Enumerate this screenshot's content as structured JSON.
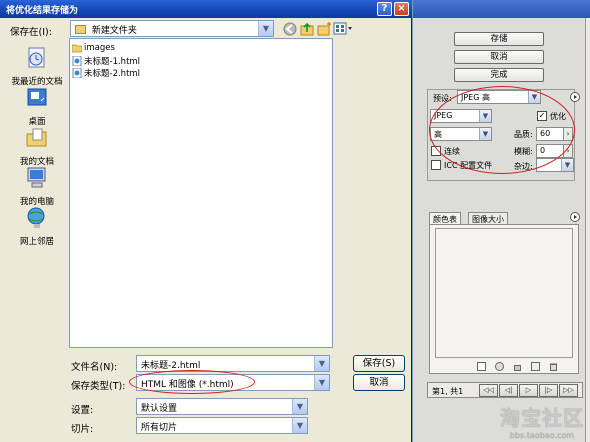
{
  "window": {
    "title": "将优化结果存储为",
    "help_glyph": "?",
    "close_glyph": "×"
  },
  "toolbar": {
    "save_in_label": "保存在(I):",
    "save_in_value": "新建文件夹"
  },
  "places": [
    {
      "label": "我最近的文档",
      "icon": "recent-documents-icon"
    },
    {
      "label": "桌面",
      "icon": "desktop-icon"
    },
    {
      "label": "我的文档",
      "icon": "my-documents-icon"
    },
    {
      "label": "我的电脑",
      "icon": "my-computer-icon"
    },
    {
      "label": "网上邻居",
      "icon": "network-places-icon"
    }
  ],
  "files": [
    {
      "name": "images",
      "icon": "folder-icon"
    },
    {
      "name": "未标题-1.html",
      "icon": "html-file-icon"
    },
    {
      "name": "未标题-2.html",
      "icon": "html-file-icon"
    }
  ],
  "form": {
    "filename_label": "文件名(N):",
    "filename_value": "未标题-2.html",
    "filetype_label": "保存类型(T):",
    "filetype_value": "HTML 和图像 (*.html)",
    "save_button": "保存(S)",
    "cancel_button": "取消",
    "settings_label": "设置:",
    "settings_value": "默认设置",
    "slices_label": "切片:",
    "slices_value": "所有切片"
  },
  "right_panel": {
    "buttons": {
      "save": "存储",
      "cancel": "取消",
      "done": "完成"
    },
    "preset_label": "预设:",
    "preset_value": "JPEG 高",
    "format_value": "JPEG",
    "optimize_label": "优化",
    "optimize_checked": "✓",
    "quality_level_value": "高",
    "quality_label": "品质:",
    "quality_value": "60",
    "progressive_label": "连续",
    "blur_label": "模糊:",
    "blur_value": "0",
    "icc_label": "ICC 配置文件",
    "matte_label": "杂边:",
    "tab_color_table": "颜色表",
    "tab_image_size": "图像大小",
    "status_text": "第1, 共1",
    "nav": [
      "◁◁",
      "◁|",
      "▷",
      "|▷",
      "▷▷"
    ]
  },
  "watermark": {
    "brand": "淘宝社区",
    "url": "bbs.taobao.com"
  }
}
